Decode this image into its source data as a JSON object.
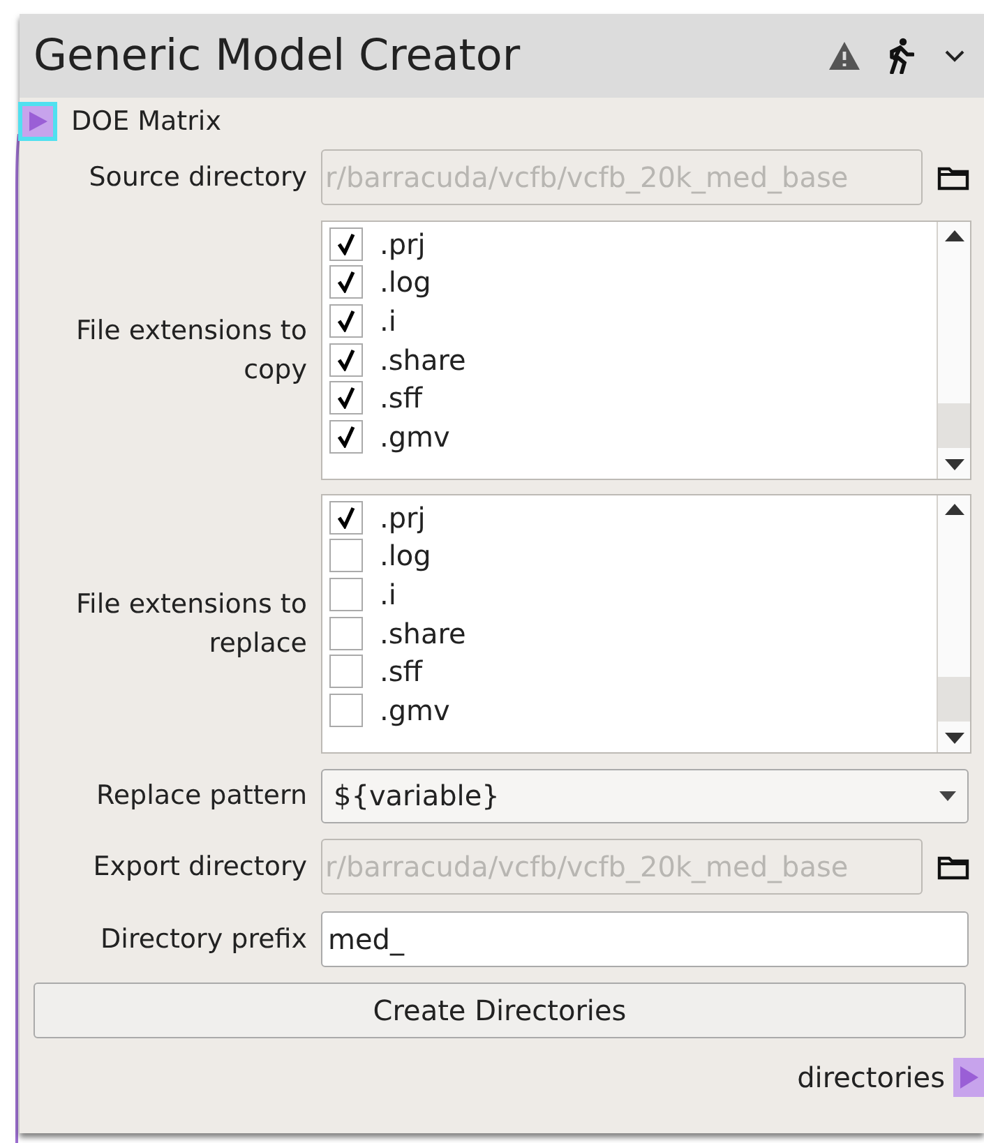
{
  "node": {
    "title": "Generic Model Creator",
    "input_port": {
      "label": "DOE Matrix",
      "selected": true
    },
    "source_directory": {
      "label": "Source directory",
      "value": "r/barracuda/vcfb/vcfb_20k_med_base",
      "disabled": true
    },
    "copy_extensions": {
      "label": "File extensions to copy",
      "items": [
        {
          "label": ".prj",
          "checked": true
        },
        {
          "label": ".log",
          "checked": true
        },
        {
          "label": ".i",
          "checked": true
        },
        {
          "label": ".share",
          "checked": true
        },
        {
          "label": ".sff",
          "checked": true
        },
        {
          "label": ".gmv",
          "checked": true
        }
      ]
    },
    "replace_extensions": {
      "label": "File extensions to replace",
      "items": [
        {
          "label": ".prj",
          "checked": true
        },
        {
          "label": ".log",
          "checked": false
        },
        {
          "label": ".i",
          "checked": false
        },
        {
          "label": ".share",
          "checked": false
        },
        {
          "label": ".sff",
          "checked": false
        },
        {
          "label": ".gmv",
          "checked": false
        }
      ]
    },
    "replace_pattern": {
      "label": "Replace pattern",
      "value": "${variable}"
    },
    "export_directory": {
      "label": "Export directory",
      "value": "r/barracuda/vcfb/vcfb_20k_med_base",
      "disabled": true
    },
    "directory_prefix": {
      "label": "Directory prefix",
      "value": "med_"
    },
    "button": "Create Directories",
    "output_port": {
      "label": "directories"
    }
  }
}
